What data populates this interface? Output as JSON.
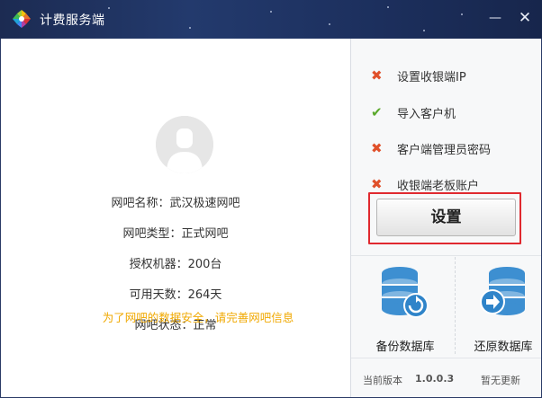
{
  "window": {
    "title": "计费服务端",
    "minimize_glyph": "—",
    "close_glyph": "✕"
  },
  "profile": {
    "rows": [
      {
        "key": "网吧名称：",
        "value": "武汉极速网吧"
      },
      {
        "key": "网吧类型：",
        "value": "正式网吧"
      },
      {
        "key": "授权机器：",
        "value": "200台"
      },
      {
        "key": "可用天数：",
        "value": "264天"
      },
      {
        "key": "网吧状态：",
        "value": "正常"
      }
    ],
    "notice": "为了网吧的数据安全，请完善网吧信息"
  },
  "checklist": [
    {
      "label": "设置收银端IP",
      "status": "incomplete",
      "glyph": "✖"
    },
    {
      "label": "导入客户机",
      "status": "complete",
      "glyph": "✔"
    },
    {
      "label": "客户端管理员密码",
      "status": "incomplete",
      "glyph": "✖"
    },
    {
      "label": "收银端老板账户",
      "status": "incomplete",
      "glyph": "✖"
    }
  ],
  "setup_button": "设置",
  "tools": {
    "backup": "备份数据库",
    "restore": "还原数据库"
  },
  "version": {
    "label": "当前版本",
    "value": "1.0.0.3",
    "status": "暂无更新"
  },
  "colors": {
    "titlebar": "#233a6d",
    "incomplete": "#e0502a",
    "complete": "#5aa92c",
    "notice": "#f0a800",
    "highlight": "#e0292f",
    "db_icon": "#3d8fd1"
  }
}
